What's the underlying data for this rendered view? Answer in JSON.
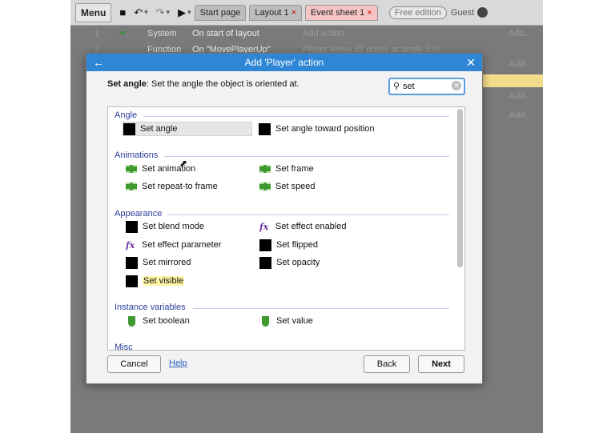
{
  "app": {
    "toolbar": {
      "menu_label": "Menu",
      "tabs": [
        {
          "label": "Start page"
        },
        {
          "label": "Layout 1",
          "close": "×"
        },
        {
          "label": "Event sheet 1",
          "close": "×"
        }
      ],
      "free_edition": "Free edition",
      "guest": "Guest"
    },
    "events": [
      {
        "num": "1",
        "object": "System",
        "condition": "On start of layout",
        "action": "Add action",
        "add": "Add..."
      },
      {
        "num": "2",
        "object": "Function",
        "condition": "On \"MovePlayerUp\"",
        "action": "Player      Move 32 pixels at angle 270",
        "add": ""
      }
    ],
    "side_adds": [
      "Add...",
      "Add...",
      "Add..."
    ]
  },
  "dialog": {
    "title": "Add 'Player' action",
    "description_bold": "Set angle",
    "description_rest": ": Set the angle the object is oriented at.",
    "search_value": "set",
    "sections": [
      {
        "title": "Angle",
        "items": [
          {
            "label": "Set angle",
            "icon": "black-square-icon",
            "highlighted": true
          },
          {
            "label": "Set angle toward position",
            "icon": "black-square-icon"
          }
        ]
      },
      {
        "title": "Animations",
        "items": [
          {
            "label": "Set animation",
            "icon": "film-icon"
          },
          {
            "label": "Set frame",
            "icon": "film-icon"
          },
          {
            "label": "Set repeat-to frame",
            "icon": "film-icon"
          },
          {
            "label": "Set speed",
            "icon": "film-icon"
          }
        ]
      },
      {
        "title": "Appearance",
        "items": [
          {
            "label": "Set blend mode",
            "icon": "black-square-icon"
          },
          {
            "label": "Set effect enabled",
            "icon": "fx-icon"
          },
          {
            "label": "Set effect parameter",
            "icon": "fx-icon"
          },
          {
            "label": "Set flipped",
            "icon": "black-square-icon"
          },
          {
            "label": "Set mirrored",
            "icon": "black-square-icon"
          },
          {
            "label": "Set opacity",
            "icon": "black-square-icon"
          },
          {
            "label": "Set visible",
            "icon": "black-square-icon"
          }
        ]
      },
      {
        "title": "Instance variables",
        "items": [
          {
            "label": "Set boolean",
            "icon": "shield-icon"
          },
          {
            "label": "Set value",
            "icon": "shield-icon"
          }
        ]
      },
      {
        "title": "Misc",
        "items": []
      }
    ],
    "buttons": {
      "cancel": "Cancel",
      "help": "Help",
      "back": "Back",
      "next": "Next"
    }
  },
  "colors": {
    "titlebar": "#2f86d4",
    "section_text": "#2a3c9a",
    "highlight": "#fff6a8",
    "icon_green": "#3e9a2e",
    "fx_purple": "#6a2fa0"
  }
}
